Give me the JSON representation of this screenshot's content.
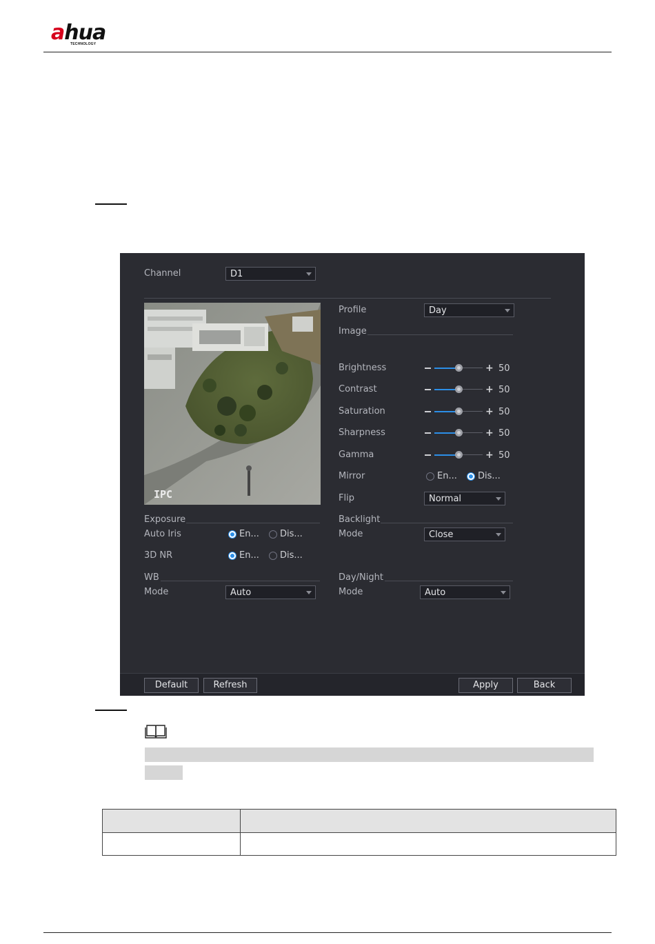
{
  "doc": {
    "logo_text": "alhua",
    "logo_subtext": "TECHNOLOGY"
  },
  "ui": {
    "channel": {
      "label": "Channel",
      "value": "D1"
    },
    "profile": {
      "label": "Profile",
      "value": "Day"
    },
    "image_section": "Image",
    "sliders": [
      {
        "label": "Brightness",
        "value": "50",
        "level": 0.5
      },
      {
        "label": "Contrast",
        "value": "50",
        "level": 0.5
      },
      {
        "label": "Saturation",
        "value": "50",
        "level": 0.5
      },
      {
        "label": "Sharpness",
        "value": "50",
        "level": 0.5
      },
      {
        "label": "Gamma",
        "value": "50",
        "level": 0.5
      }
    ],
    "mirror": {
      "label": "Mirror",
      "enable": "En...",
      "disable": "Dis...",
      "selected": "disable"
    },
    "flip": {
      "label": "Flip",
      "value": "Normal"
    },
    "preview_overlay": "IPC",
    "exposure": {
      "section": "Exposure",
      "auto_iris": {
        "label": "Auto Iris",
        "enable": "En...",
        "disable": "Dis...",
        "selected": "enable"
      },
      "nr3d": {
        "label": "3D NR",
        "enable": "En...",
        "disable": "Dis...",
        "selected": "enable"
      }
    },
    "backlight": {
      "section": "Backlight",
      "mode_label": "Mode",
      "mode_value": "Close"
    },
    "wb": {
      "section": "WB",
      "mode_label": "Mode",
      "mode_value": "Auto"
    },
    "day_night": {
      "section": "Day/Night",
      "mode_label": "Mode",
      "mode_value": "Auto"
    },
    "buttons": {
      "default": "Default",
      "refresh": "Refresh",
      "apply": "Apply",
      "back": "Back"
    }
  }
}
